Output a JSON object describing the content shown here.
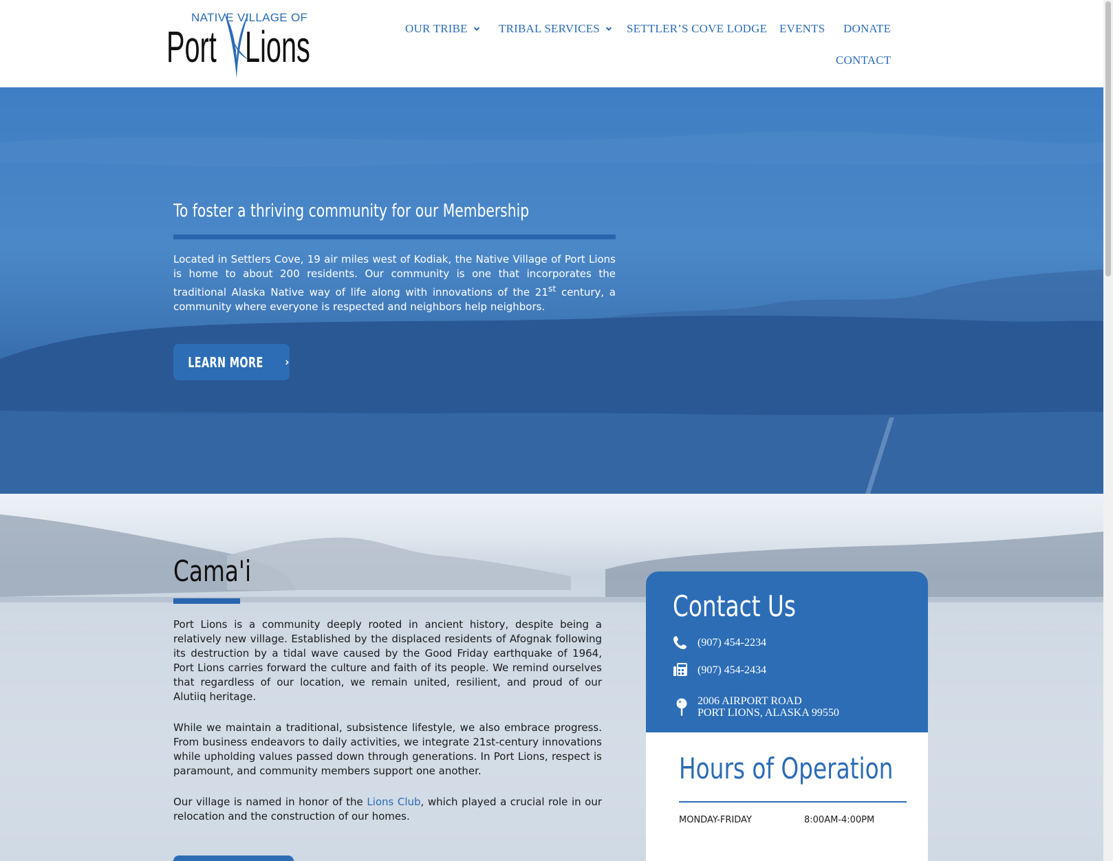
{
  "logo": {
    "top_text": "NATIVE VILLAGE OF",
    "word1": "Port",
    "word2": "Lions"
  },
  "nav": {
    "items": [
      {
        "label": "OUR TRIBE",
        "has_dropdown": true
      },
      {
        "label": "TRIBAL SERVICES",
        "has_dropdown": true
      },
      {
        "label": "SETTLER’S COVE LODGE",
        "has_dropdown": false
      },
      {
        "label": "EVENTS",
        "has_dropdown": false
      },
      {
        "label": "DONATE",
        "has_dropdown": false
      },
      {
        "label": "CONTACT",
        "has_dropdown": false
      }
    ]
  },
  "hero": {
    "title": "To foster a thriving community for our Membership",
    "text_before_sup": "Located in Settlers Cove, 19 air miles west of Kodiak, the Native Village of Port Lions is home to about 200 residents. Our community is one that incorporates the traditional Alaska Native way of life along with innovations of the 21",
    "text_sup": "st",
    "text_after_sup": " century, a community where everyone is respected and neighbors help neighbors.",
    "button_label": "LEARN MORE",
    "button_icon": "chevron-right-icon"
  },
  "about": {
    "title": "Cama'i",
    "paragraph1": "Port Lions is a community deeply rooted in ancient history, despite being a relatively new village. Established by the displaced residents of Afognak following its destruction by a tidal wave caused by the Good Friday earthquake of 1964, Port Lions carries forward the culture and faith of its people. We remind ourselves that regardless of our location, we remain united, resilient, and proud of our Alutiiq heritage.",
    "paragraph2": "While we maintain a traditional, subsistence lifestyle, we also embrace progress. From business endeavors to daily activities, we integrate 21st-century innovations while upholding values passed down through generations. In Port Lions, respect is paramount, and community members support one another.",
    "paragraph3_before_link": "Our village is named in honor of the ",
    "paragraph3_link": "Lions Club",
    "paragraph3_after_link": ", which played a crucial role in our relocation and the construction of our homes."
  },
  "contact": {
    "title": "Contact Us",
    "phone": "(907) 454-2234",
    "phone_icon": "phone-icon",
    "fax": "(907) 454-2434",
    "fax_icon": "fax-icon",
    "address_line1": "2006 AIRPORT ROAD",
    "address_line2": "PORT LIONS, ALASKA 99550",
    "address_icon": "map-pin-icon"
  },
  "hours": {
    "title": "Hours of Operation",
    "rows": [
      {
        "day": "MONDAY-FRIDAY",
        "time": "8:00AM-4:00PM"
      }
    ]
  },
  "colors": {
    "brand_blue": "#2c6db6",
    "nav_text": "#2b6cb5",
    "hero_overlay": "#3f7ec3"
  }
}
